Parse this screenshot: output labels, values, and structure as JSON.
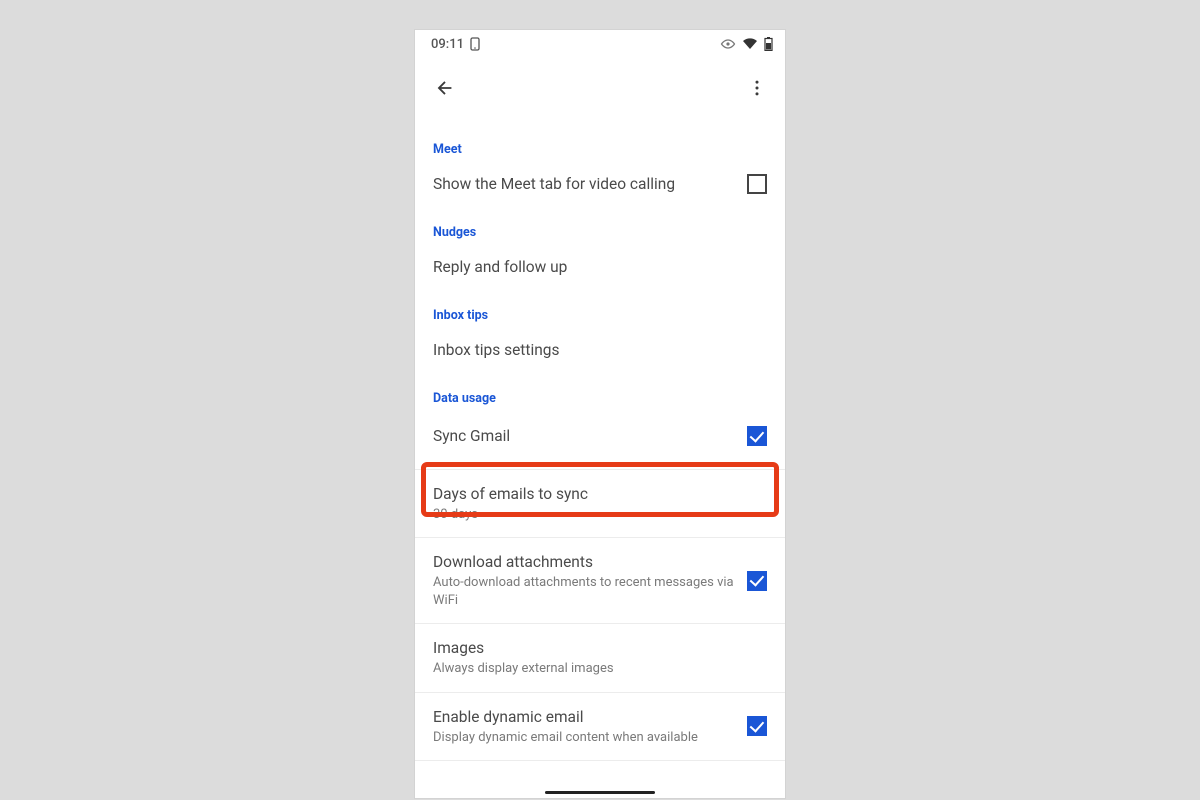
{
  "statusbar": {
    "time": "09:11"
  },
  "sections": {
    "meet": {
      "header": "Meet",
      "show_tab": {
        "title": "Show the Meet tab for video calling"
      }
    },
    "nudges": {
      "header": "Nudges",
      "reply": {
        "title": "Reply and follow up"
      }
    },
    "inbox_tips": {
      "header": "Inbox tips",
      "settings": {
        "title": "Inbox tips settings"
      }
    },
    "data_usage": {
      "header": "Data usage",
      "sync": {
        "title": "Sync Gmail"
      },
      "days": {
        "title": "Days of emails to sync",
        "sub": "30 days"
      },
      "attachments": {
        "title": "Download attachments",
        "sub": "Auto-download attachments to recent messages via WiFi"
      },
      "images": {
        "title": "Images",
        "sub": "Always display external images"
      },
      "dynamic": {
        "title": "Enable dynamic email",
        "sub": "Display dynamic email content when available"
      }
    }
  }
}
